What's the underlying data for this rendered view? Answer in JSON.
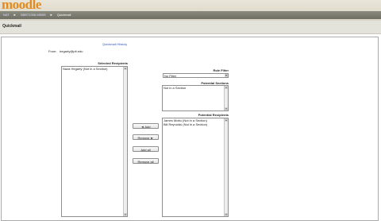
{
  "header": {
    "logo": "moodle",
    "breadcrumb": [
      "NAT",
      "SBBT1306.MSBS",
      "Quickmail"
    ]
  },
  "page_title": "Quickmail",
  "history_link": "Quickmail History",
  "from": {
    "label": "From:",
    "value": "hegarty@pit.edu"
  },
  "selected_recipients": {
    "heading": "Selected Recipients",
    "items": [
      "Naza Hegarty (Not in a Section)"
    ]
  },
  "role_filter": {
    "heading": "Role Filter",
    "value": "No Filter"
  },
  "potential_sections": {
    "heading": "Potential Sections",
    "items": [
      "Not in a Section"
    ]
  },
  "potential_recipients": {
    "heading": "Potential Recipients",
    "items": [
      "James Mottu (Not in a Section)",
      "Bill Reynolds (Not in a Section)"
    ]
  },
  "buttons": {
    "add": "◄ Add",
    "remove": "Remove ►",
    "add_all": "Add all",
    "remove_all": "Remove all"
  }
}
